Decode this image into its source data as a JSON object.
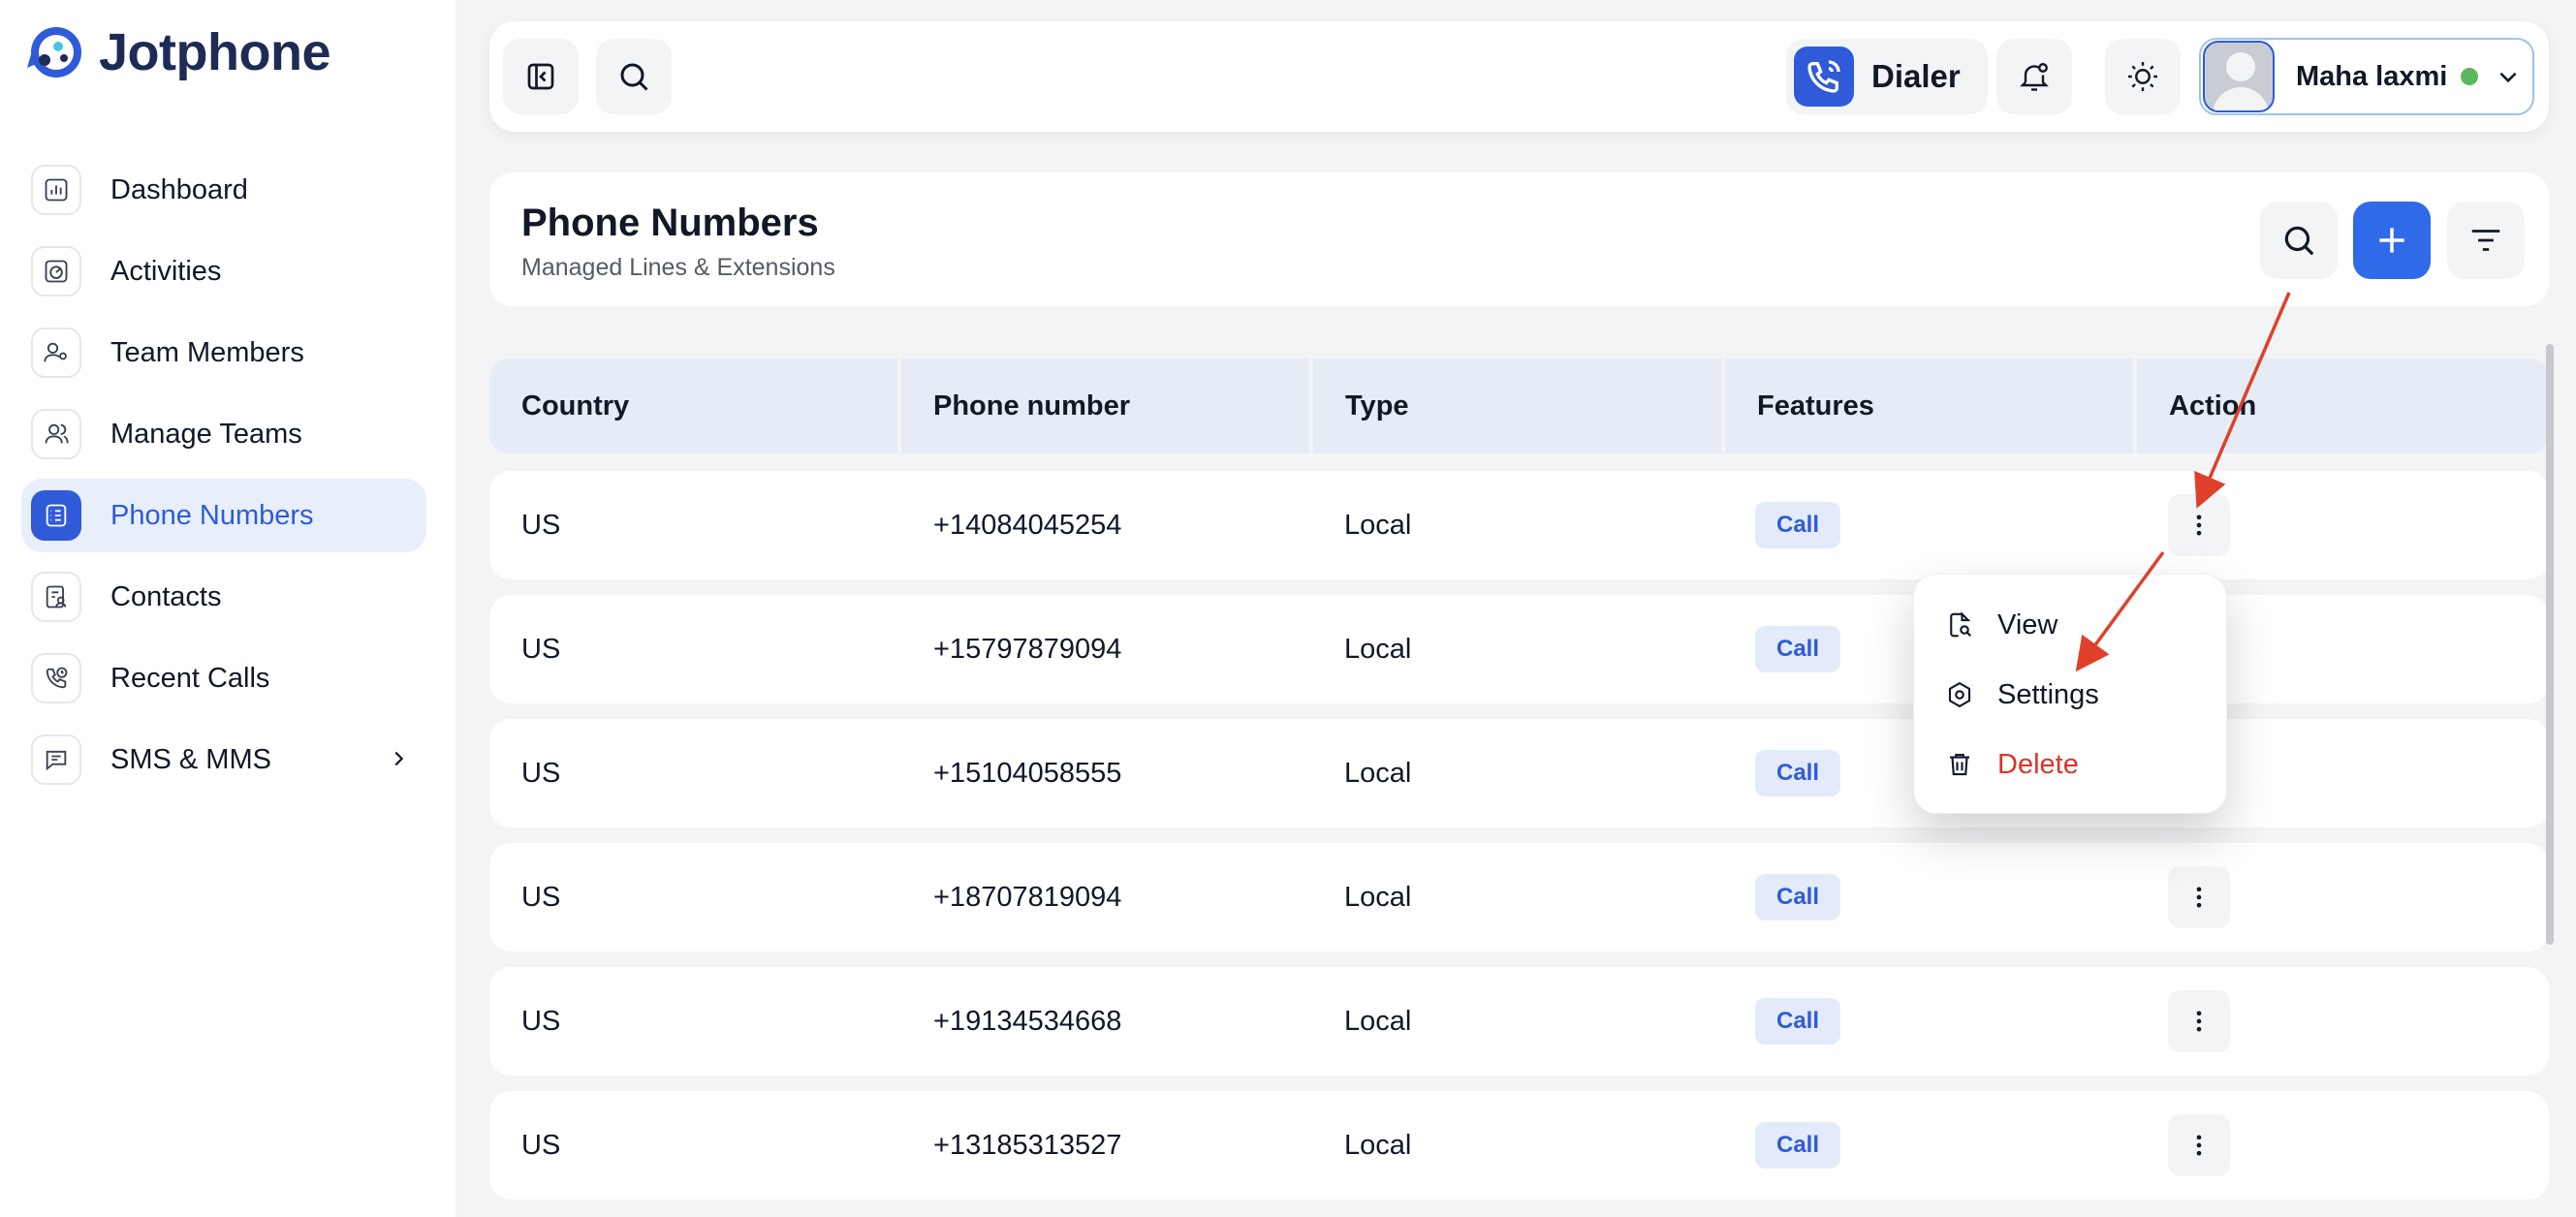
{
  "app": {
    "name": "Jotphone"
  },
  "sidebar": {
    "items": [
      {
        "label": "Dashboard",
        "icon": "chart-bars-icon",
        "active": false
      },
      {
        "label": "Activities",
        "icon": "gauge-icon",
        "active": false
      },
      {
        "label": "Team Members",
        "icon": "user-gear-icon",
        "active": false
      },
      {
        "label": "Manage Teams",
        "icon": "users-icon",
        "active": false
      },
      {
        "label": "Phone Numbers",
        "icon": "phone-book-icon",
        "active": true
      },
      {
        "label": "Contacts",
        "icon": "contact-card-icon",
        "active": false
      },
      {
        "label": "Recent Calls",
        "icon": "phone-history-icon",
        "active": false
      },
      {
        "label": "SMS & MMS",
        "icon": "message-icon",
        "active": false,
        "has_submenu": true
      }
    ]
  },
  "topbar": {
    "dialer_label": "Dialer",
    "user_name": "Maha laxmi",
    "user_status": "online",
    "status_color": "#5cb85c"
  },
  "header": {
    "title": "Phone Numbers",
    "subtitle": "Managed Lines & Extensions"
  },
  "table": {
    "columns": [
      "Country",
      "Phone number",
      "Type",
      "Features",
      "Action"
    ],
    "rows": [
      {
        "country": "US",
        "number": "+14084045254",
        "type": "Local",
        "feature": "Call"
      },
      {
        "country": "US",
        "number": "+15797879094",
        "type": "Local",
        "feature": "Call"
      },
      {
        "country": "US",
        "number": "+15104058555",
        "type": "Local",
        "feature": "Call"
      },
      {
        "country": "US",
        "number": "+18707819094",
        "type": "Local",
        "feature": "Call"
      },
      {
        "country": "US",
        "number": "+19134534668",
        "type": "Local",
        "feature": "Call"
      },
      {
        "country": "US",
        "number": "+13185313527",
        "type": "Local",
        "feature": "Call"
      }
    ]
  },
  "action_menu": {
    "items": [
      {
        "label": "View",
        "icon": "file-search-icon"
      },
      {
        "label": "Settings",
        "icon": "settings-icon"
      },
      {
        "label": "Delete",
        "icon": "trash-icon",
        "danger": true
      }
    ]
  },
  "colors": {
    "accent": "#2f5bd9",
    "danger": "#d9342b",
    "annotation": "#e0402a"
  }
}
